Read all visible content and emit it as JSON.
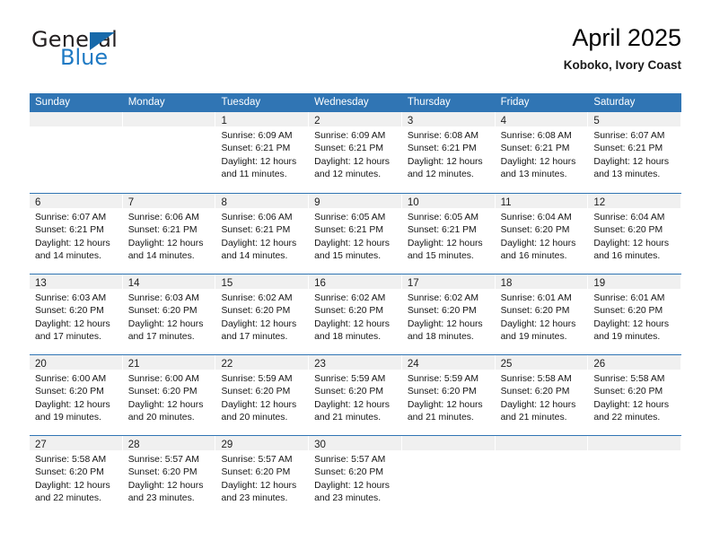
{
  "brand": {
    "word1": "General",
    "word2": "Blue",
    "triangle_color": "#1769aa",
    "blue_text_color": "#1f7ac4"
  },
  "header": {
    "title": "April 2025",
    "subtitle": "Koboko, Ivory Coast"
  },
  "theme": {
    "header_row_bg": "#3075b4",
    "week_separator": "#3075b4",
    "daynum_band_bg": "#f0f0f0",
    "text": "#161616"
  },
  "calendar": {
    "weekdays": [
      "Sunday",
      "Monday",
      "Tuesday",
      "Wednesday",
      "Thursday",
      "Friday",
      "Saturday"
    ],
    "weeks": [
      [
        {
          "day": "",
          "lines": []
        },
        {
          "day": "",
          "lines": []
        },
        {
          "day": "1",
          "lines": [
            "Sunrise: 6:09 AM",
            "Sunset: 6:21 PM",
            "Daylight: 12 hours",
            "and 11 minutes."
          ]
        },
        {
          "day": "2",
          "lines": [
            "Sunrise: 6:09 AM",
            "Sunset: 6:21 PM",
            "Daylight: 12 hours",
            "and 12 minutes."
          ]
        },
        {
          "day": "3",
          "lines": [
            "Sunrise: 6:08 AM",
            "Sunset: 6:21 PM",
            "Daylight: 12 hours",
            "and 12 minutes."
          ]
        },
        {
          "day": "4",
          "lines": [
            "Sunrise: 6:08 AM",
            "Sunset: 6:21 PM",
            "Daylight: 12 hours",
            "and 13 minutes."
          ]
        },
        {
          "day": "5",
          "lines": [
            "Sunrise: 6:07 AM",
            "Sunset: 6:21 PM",
            "Daylight: 12 hours",
            "and 13 minutes."
          ]
        }
      ],
      [
        {
          "day": "6",
          "lines": [
            "Sunrise: 6:07 AM",
            "Sunset: 6:21 PM",
            "Daylight: 12 hours",
            "and 14 minutes."
          ]
        },
        {
          "day": "7",
          "lines": [
            "Sunrise: 6:06 AM",
            "Sunset: 6:21 PM",
            "Daylight: 12 hours",
            "and 14 minutes."
          ]
        },
        {
          "day": "8",
          "lines": [
            "Sunrise: 6:06 AM",
            "Sunset: 6:21 PM",
            "Daylight: 12 hours",
            "and 14 minutes."
          ]
        },
        {
          "day": "9",
          "lines": [
            "Sunrise: 6:05 AM",
            "Sunset: 6:21 PM",
            "Daylight: 12 hours",
            "and 15 minutes."
          ]
        },
        {
          "day": "10",
          "lines": [
            "Sunrise: 6:05 AM",
            "Sunset: 6:21 PM",
            "Daylight: 12 hours",
            "and 15 minutes."
          ]
        },
        {
          "day": "11",
          "lines": [
            "Sunrise: 6:04 AM",
            "Sunset: 6:20 PM",
            "Daylight: 12 hours",
            "and 16 minutes."
          ]
        },
        {
          "day": "12",
          "lines": [
            "Sunrise: 6:04 AM",
            "Sunset: 6:20 PM",
            "Daylight: 12 hours",
            "and 16 minutes."
          ]
        }
      ],
      [
        {
          "day": "13",
          "lines": [
            "Sunrise: 6:03 AM",
            "Sunset: 6:20 PM",
            "Daylight: 12 hours",
            "and 17 minutes."
          ]
        },
        {
          "day": "14",
          "lines": [
            "Sunrise: 6:03 AM",
            "Sunset: 6:20 PM",
            "Daylight: 12 hours",
            "and 17 minutes."
          ]
        },
        {
          "day": "15",
          "lines": [
            "Sunrise: 6:02 AM",
            "Sunset: 6:20 PM",
            "Daylight: 12 hours",
            "and 17 minutes."
          ]
        },
        {
          "day": "16",
          "lines": [
            "Sunrise: 6:02 AM",
            "Sunset: 6:20 PM",
            "Daylight: 12 hours",
            "and 18 minutes."
          ]
        },
        {
          "day": "17",
          "lines": [
            "Sunrise: 6:02 AM",
            "Sunset: 6:20 PM",
            "Daylight: 12 hours",
            "and 18 minutes."
          ]
        },
        {
          "day": "18",
          "lines": [
            "Sunrise: 6:01 AM",
            "Sunset: 6:20 PM",
            "Daylight: 12 hours",
            "and 19 minutes."
          ]
        },
        {
          "day": "19",
          "lines": [
            "Sunrise: 6:01 AM",
            "Sunset: 6:20 PM",
            "Daylight: 12 hours",
            "and 19 minutes."
          ]
        }
      ],
      [
        {
          "day": "20",
          "lines": [
            "Sunrise: 6:00 AM",
            "Sunset: 6:20 PM",
            "Daylight: 12 hours",
            "and 19 minutes."
          ]
        },
        {
          "day": "21",
          "lines": [
            "Sunrise: 6:00 AM",
            "Sunset: 6:20 PM",
            "Daylight: 12 hours",
            "and 20 minutes."
          ]
        },
        {
          "day": "22",
          "lines": [
            "Sunrise: 5:59 AM",
            "Sunset: 6:20 PM",
            "Daylight: 12 hours",
            "and 20 minutes."
          ]
        },
        {
          "day": "23",
          "lines": [
            "Sunrise: 5:59 AM",
            "Sunset: 6:20 PM",
            "Daylight: 12 hours",
            "and 21 minutes."
          ]
        },
        {
          "day": "24",
          "lines": [
            "Sunrise: 5:59 AM",
            "Sunset: 6:20 PM",
            "Daylight: 12 hours",
            "and 21 minutes."
          ]
        },
        {
          "day": "25",
          "lines": [
            "Sunrise: 5:58 AM",
            "Sunset: 6:20 PM",
            "Daylight: 12 hours",
            "and 21 minutes."
          ]
        },
        {
          "day": "26",
          "lines": [
            "Sunrise: 5:58 AM",
            "Sunset: 6:20 PM",
            "Daylight: 12 hours",
            "and 22 minutes."
          ]
        }
      ],
      [
        {
          "day": "27",
          "lines": [
            "Sunrise: 5:58 AM",
            "Sunset: 6:20 PM",
            "Daylight: 12 hours",
            "and 22 minutes."
          ]
        },
        {
          "day": "28",
          "lines": [
            "Sunrise: 5:57 AM",
            "Sunset: 6:20 PM",
            "Daylight: 12 hours",
            "and 23 minutes."
          ]
        },
        {
          "day": "29",
          "lines": [
            "Sunrise: 5:57 AM",
            "Sunset: 6:20 PM",
            "Daylight: 12 hours",
            "and 23 minutes."
          ]
        },
        {
          "day": "30",
          "lines": [
            "Sunrise: 5:57 AM",
            "Sunset: 6:20 PM",
            "Daylight: 12 hours",
            "and 23 minutes."
          ]
        },
        {
          "day": "",
          "lines": []
        },
        {
          "day": "",
          "lines": []
        },
        {
          "day": "",
          "lines": []
        }
      ]
    ]
  }
}
